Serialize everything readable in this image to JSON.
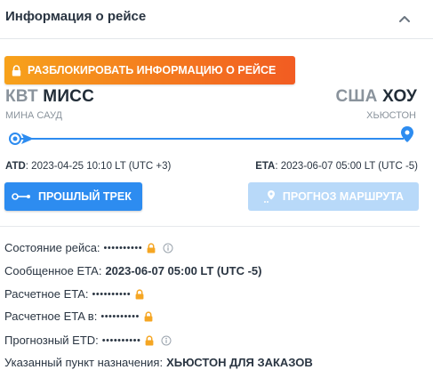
{
  "section": {
    "title": "Информация о рейсе"
  },
  "unlock": {
    "label": "РАЗБЛОКИРОВАТЬ ИНФОРМАЦИЮ О РЕЙСЕ"
  },
  "route": {
    "from": {
      "code": "КВТ",
      "name": "МИСС",
      "full": "МИНА САУД"
    },
    "to": {
      "code": "США",
      "name": "ХОУ",
      "full": "ХЬЮСТОН"
    }
  },
  "times": {
    "atd_label": "ATD",
    "atd_value": ": 2023-04-25 10:10 LT (UTC +3)",
    "eta_label": "ETA",
    "eta_value": ": 2023-06-07 05:00 LT (UTC -5)"
  },
  "buttons": {
    "past_track": "ПРОШЛЫЙ ТРЕК",
    "route_forecast": "ПРОГНОЗ МАРШРУТА"
  },
  "details": {
    "status_label": "Состояние рейса:",
    "status_value": "••••••••••",
    "reported_eta_label": "Сообщенное ETA:",
    "reported_eta_value": "2023-06-07 05:00 LT (UTC -5)",
    "calc_eta_label": "Расчетное ETA:",
    "calc_eta_value": "••••••••••",
    "calc_eta_in_label": "Расчетное ETA в:",
    "calc_eta_in_value": "••••••••••",
    "forecast_etd_label": "Прогнозный ETD:",
    "forecast_etd_value": "••••••••••",
    "destination_label": "Указанный пункт назначения:",
    "destination_value": "ХЬЮСТОН ДЛЯ ЗАКАЗОВ"
  },
  "colors": {
    "accent_blue": "#2d8cf0",
    "unlock_orange": "#f47a1f",
    "lock_gold": "#f5a623",
    "disabled_blue": "#b8d9f9"
  },
  "icons": {
    "collapse": "chevron-up-icon",
    "lock": "lock-icon",
    "info": "info-icon",
    "track": "track-icon",
    "forecast": "map-pin-icon",
    "origin": "origin-marker-icon",
    "destination": "destination-pin-icon"
  }
}
